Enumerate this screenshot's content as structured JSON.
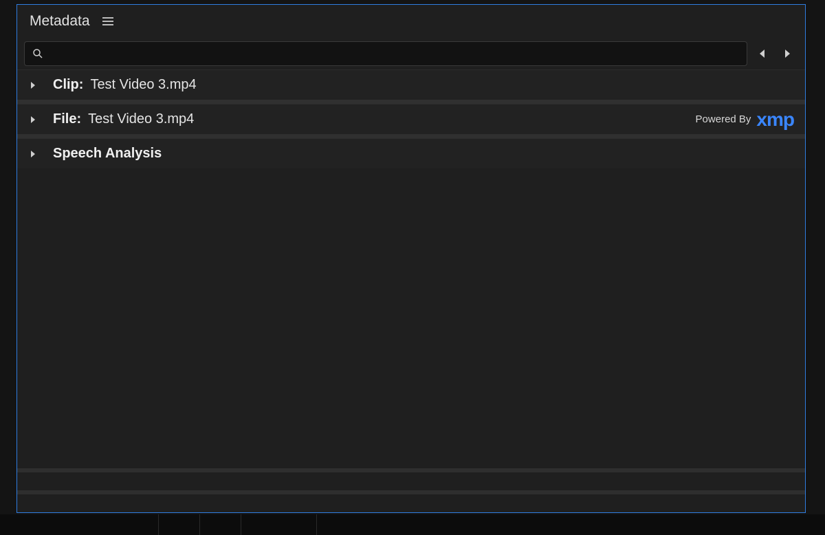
{
  "panel": {
    "title": "Metadata",
    "search": {
      "value": "",
      "placeholder": ""
    },
    "sections": [
      {
        "label": "Clip:",
        "value": "Test Video 3.mp4"
      },
      {
        "label": "File:",
        "value": "Test Video 3.mp4"
      },
      {
        "label": "Speech Analysis",
        "value": ""
      }
    ],
    "powered_by": {
      "text": "Powered By",
      "brand": "xmp"
    }
  }
}
